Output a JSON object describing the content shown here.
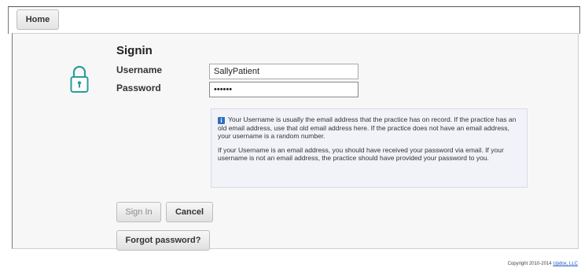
{
  "nav": {
    "home_label": "Home"
  },
  "signin": {
    "title": "Signin",
    "username_label": "Username",
    "username_value": "SallyPatient",
    "password_label": "Password",
    "password_mask": "••••••",
    "lock_icon": "lock-icon"
  },
  "info": {
    "icon": "info-icon",
    "paragraph1": "Your Username is usually the email address that the practice has on record. If the practice has an old email address, use that old email address here. If the practice does not have an email address, your username is a random number.",
    "paragraph2": "If your Username is an email address, you should have received your password via email. If your username is not an email address, the practice should have provided your password to you."
  },
  "buttons": {
    "signin_label": "Sign In",
    "cancel_label": "Cancel",
    "forgot_label": "Forgot password?"
  },
  "footer": {
    "copyright_text": "Copyright 2010-2014",
    "company_link": "Updox, LLC"
  },
  "colors": {
    "accent": "#2f6fbf",
    "link": "#1a56c4"
  }
}
